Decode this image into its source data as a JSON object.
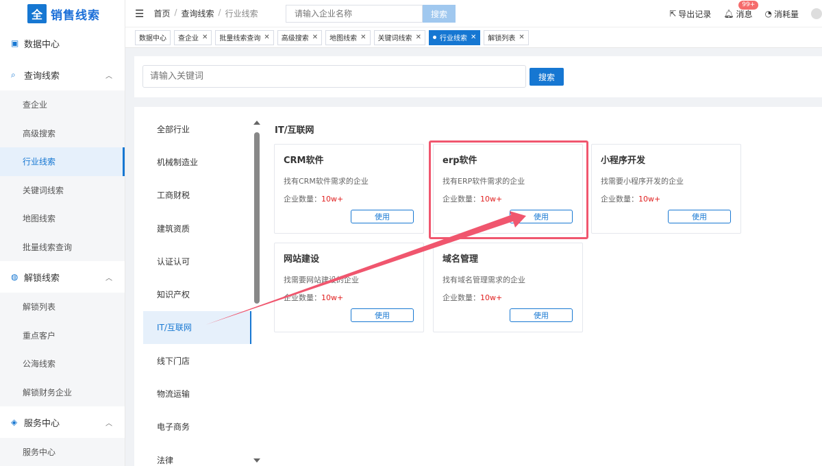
{
  "app": {
    "logo_char": "全",
    "logo_text": "销售线索"
  },
  "sidebar": {
    "groups": [
      {
        "label": "数据中心",
        "icon": "dashboard-icon",
        "items": []
      },
      {
        "label": "查询线索",
        "icon": "search-doc-icon",
        "items": [
          "查企业",
          "高级搜索",
          "行业线索",
          "关键词线索",
          "地图线索",
          "批量线索查询"
        ]
      },
      {
        "label": "解锁线索",
        "icon": "globe-icon",
        "items": [
          "解锁列表",
          "重点客户",
          "公海线索",
          "解锁财务企业"
        ]
      },
      {
        "label": "服务中心",
        "icon": "cube-icon",
        "items": [
          "服务中心"
        ]
      }
    ],
    "active_item": "行业线索"
  },
  "header": {
    "breadcrumb": [
      "首页",
      "查询线索",
      "行业线索"
    ],
    "search_placeholder": "请输入企业名称",
    "search_button": "搜索",
    "export_label": "导出记录",
    "messages_label": "消息",
    "messages_badge": "99+",
    "consumption_label": "消耗量"
  },
  "tabs": [
    {
      "label": "数据中心",
      "closable": false,
      "active": false
    },
    {
      "label": "查企业",
      "closable": true,
      "active": false
    },
    {
      "label": "批量线索查询",
      "closable": true,
      "active": false
    },
    {
      "label": "高级搜索",
      "closable": true,
      "active": false
    },
    {
      "label": "地图线索",
      "closable": true,
      "active": false
    },
    {
      "label": "关键词线索",
      "closable": true,
      "active": false
    },
    {
      "label": "行业线索",
      "closable": true,
      "active": true
    },
    {
      "label": "解锁列表",
      "closable": true,
      "active": false
    }
  ],
  "keyword": {
    "placeholder": "请输入关键词",
    "button": "搜索"
  },
  "industries": [
    "全部行业",
    "机械制造业",
    "工商财税",
    "建筑资质",
    "认证认可",
    "知识产权",
    "IT/互联网",
    "线下门店",
    "物流运输",
    "电子商务",
    "法律"
  ],
  "active_industry": "IT/互联网",
  "category_title": "IT/互联网",
  "cards": [
    {
      "title": "CRM软件",
      "desc": "找有CRM软件需求的企业",
      "count_label": "企业数量：",
      "count": "10w+",
      "button": "使用"
    },
    {
      "title": "erp软件",
      "desc": "找有ERP软件需求的企业",
      "count_label": "企业数量：",
      "count": "10w+",
      "button": "使用"
    },
    {
      "title": "小程序开发",
      "desc": "找需要小程序开发的企业",
      "count_label": "企业数量：",
      "count": "10w+",
      "button": "使用"
    },
    {
      "title": "网站建设",
      "desc": "找需要网站建设的企业",
      "count_label": "企业数量：",
      "count": "10w+",
      "button": "使用"
    },
    {
      "title": "域名管理",
      "desc": "找有域名管理需求的企业",
      "count_label": "企业数量：",
      "count": "10w+",
      "button": "使用"
    }
  ],
  "colors": {
    "primary": "#1677d2",
    "highlight": "#f0566e",
    "count": "#e02020"
  }
}
